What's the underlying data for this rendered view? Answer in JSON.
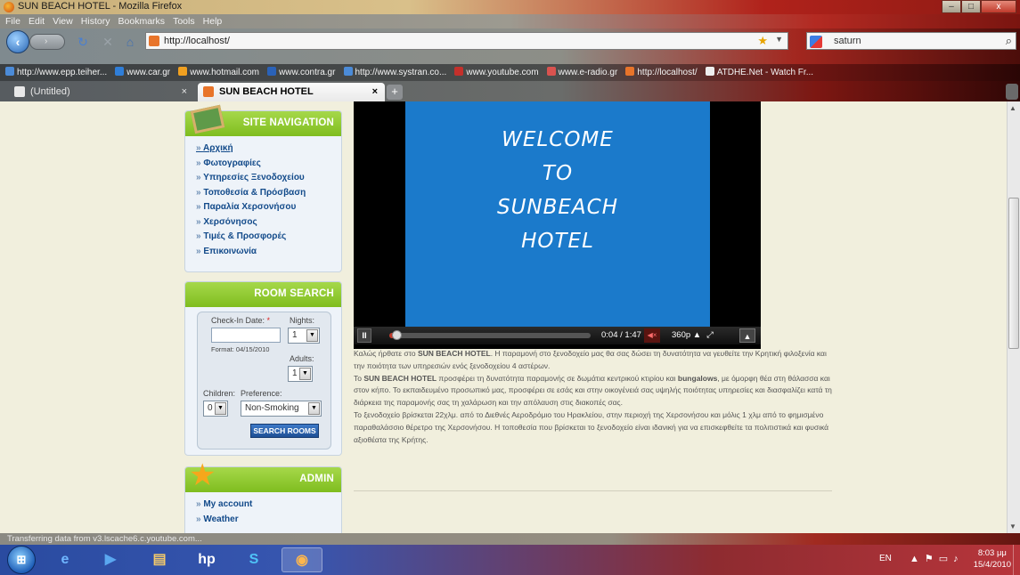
{
  "window": {
    "title": "SUN BEACH HOTEL - Mozilla Firefox",
    "min": "–",
    "max": "□",
    "close": "x"
  },
  "menu": [
    "File",
    "Edit",
    "View",
    "History",
    "Bookmarks",
    "Tools",
    "Help"
  ],
  "nav": {
    "url": "http://localhost/",
    "search_value": "saturn",
    "back_glyph": "‹",
    "forward_glyph": "›"
  },
  "bookmarks": [
    "http://www.epp.teiher...",
    "www.car.gr",
    "www.hotmail.com",
    "www.contra.gr",
    "http://www.systran.co...",
    "www.youtube.com",
    "www.e-radio.gr",
    "http://localhost/",
    "ATDHE.Net - Watch Fr..."
  ],
  "tabs": {
    "inactive": "(Untitled)",
    "active": "SUN BEACH HOTEL",
    "close": "×",
    "new": "+"
  },
  "sidebar": {
    "site_nav_title": "SITE NAVIGATION",
    "site_nav_items": [
      "Αρχική",
      "Φωτογραφίες",
      "Υπηρεσίες Ξενοδοχείου",
      "Τοποθεσία & Πρόσβαση",
      "Παραλία Χερσονήσου",
      "Χερσόνησος",
      "Τιμές & Προσφορές",
      "Επικοινωνία"
    ],
    "room_search_title": "ROOM SEARCH",
    "checkin_label": "Check-In Date:",
    "required_mark": "*",
    "nights_label": "Nights:",
    "nights_value": "1",
    "format_hint": "Format: 04/15/2010",
    "adults_label": "Adults:",
    "adults_value": "1",
    "children_label": "Children:",
    "children_value": "0",
    "preference_label": "Preference:",
    "preference_value": "Non-Smoking",
    "search_button": "SEARCH ROOMS",
    "admin_title": "ADMIN",
    "admin_items": [
      "My account",
      "Weather"
    ]
  },
  "video": {
    "welcome_lines": [
      "WELCOME",
      "TO",
      "SUNBEACH",
      "HOTEL"
    ],
    "time": "0:04 / 1:47",
    "quality": "360p ▲",
    "progress_fraction": 0.037
  },
  "article": {
    "p1_a": "Καλώς ήρθατε στο ",
    "p1_b": "SUN BEACH HOTEL",
    "p1_c": ". Η παραμονή στο ξενοδοχείο μας θα σας δώσει τη δυνατότητα να γευθείτε την Κρητική φιλοξενία και την ποιότητα των υπηρεσιών ενός ξενοδοχείου 4 αστέρων.",
    "p2_a": "Το ",
    "p2_b": "SUN BEACH HOTEL",
    "p2_c": " προσφέρει τη δυνατότητα παραμονής σε δωμάτια κεντρικού κτιρίου και ",
    "p2_d": "bungalows",
    "p2_e": ", με όμορφη θέα στη θάλασσα και στον κήπο. Το εκπαιδευμένο προσωπικό μας, προσφέρει σε εσάς και στην οικογένειά σας υψηλής ποιότητας υπηρεσίες και διασφαλίζει κατά τη διάρκεια της παραμονής σας τη χαλάρωση και την απόλαυση στις διακοπές σας.",
    "p3": "Το ξενοδοχείο βρίσκεται 22χλμ. από το Διεθνές Αεροδρόμιο του Ηρακλείου, στην περιοχή της Χερσονήσου και μόλις 1 χλμ από το φημισμένο παραθαλάσσιο θέρετρο της Χερσονήσου. Η τοποθεσία που βρίσκεται το ξενοδοχείο είναι ιδανική για να επισκεφθείτε τα πολιτιστικά και φυσικά αξιοθέατα της Κρήτης."
  },
  "status": "Transferring data from v3.lscache6.c.youtube.com...",
  "taskbar": {
    "lang": "EN",
    "time": "8:03 μμ",
    "date": "15/4/2010"
  }
}
